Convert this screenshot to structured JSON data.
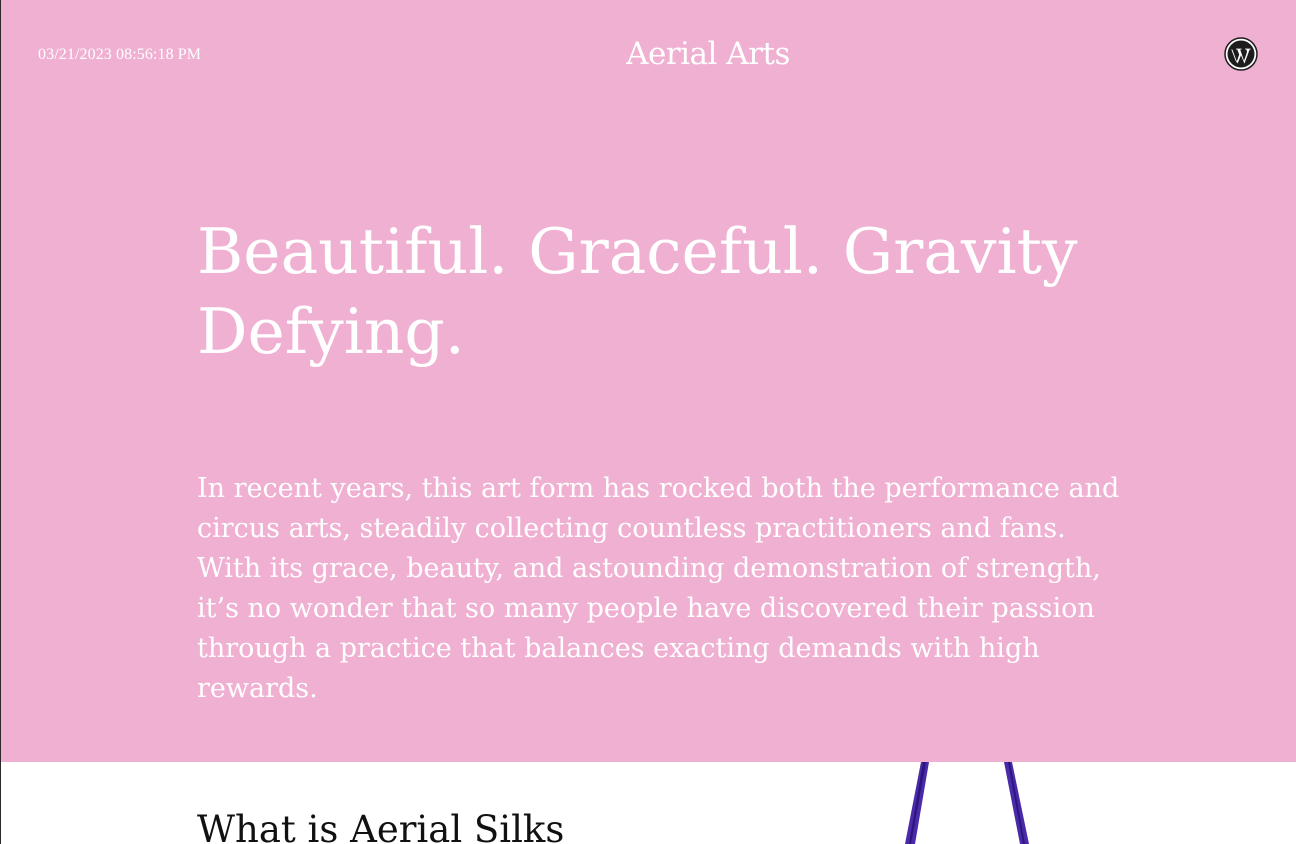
{
  "header": {
    "timestamp": "03/21/2023 08:56:18 PM",
    "site_title": "Aerial Arts",
    "logo_icon": "wordpress-icon"
  },
  "hero": {
    "headline": "Beautiful. Graceful. Gravity Defying.",
    "intro": "In recent years, this art form has rocked both the performance and circus arts, steadily collecting countless practitioners and fans. With its grace, beauty, and astounding demonstration of strength, it’s no wonder that so many people have discovered their passion through a practice that balances exacting demands with high rewards."
  },
  "section": {
    "heading": "What is Aerial Silks"
  },
  "colors": {
    "hero_background": "#f0b0d2",
    "text_light": "#ffffff",
    "silk_fabric": "#4a2aa8"
  }
}
